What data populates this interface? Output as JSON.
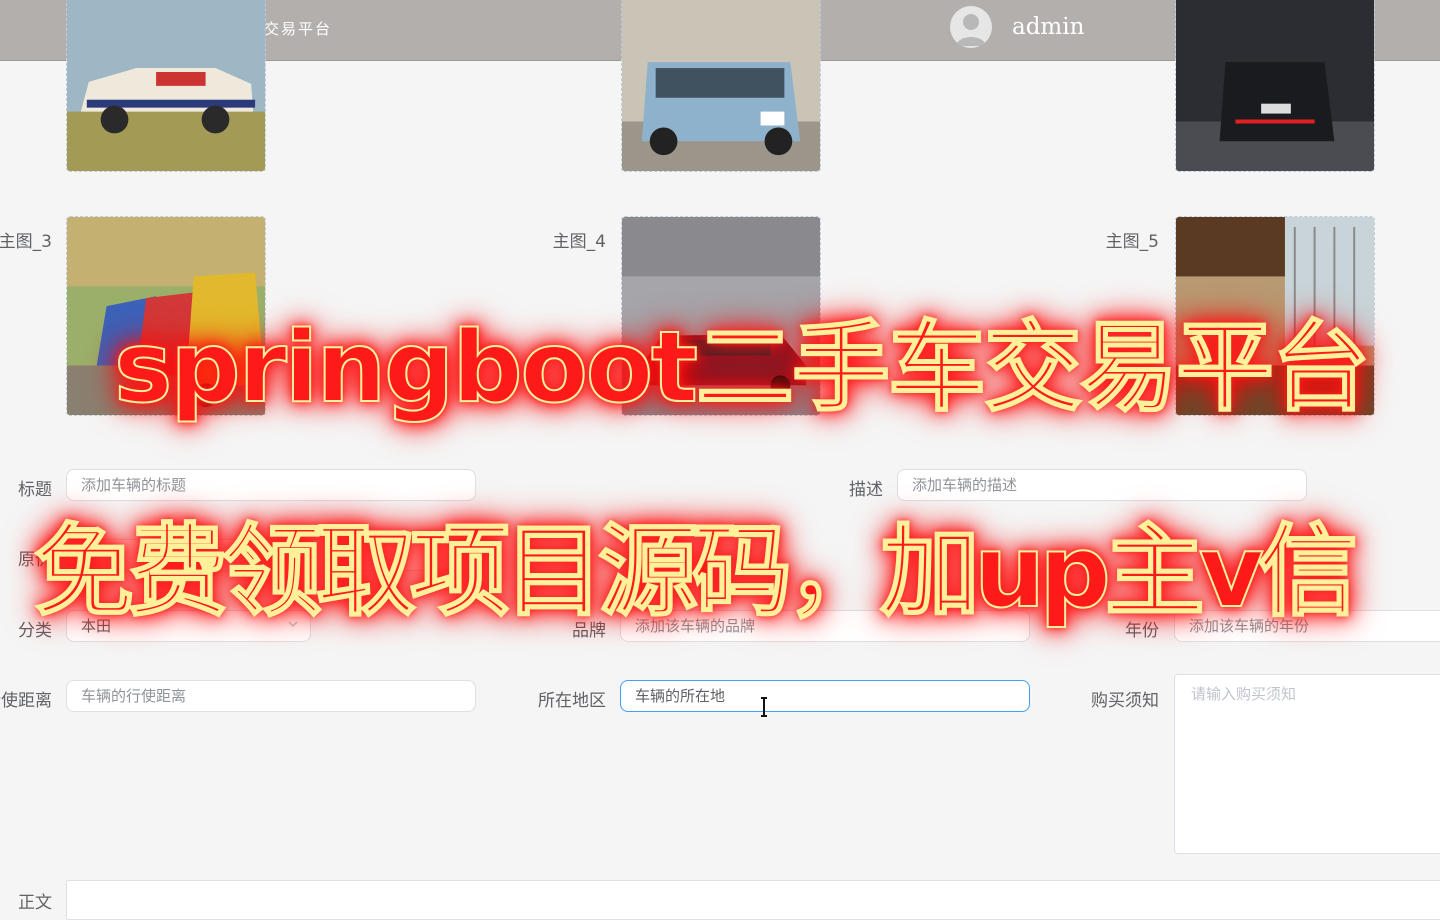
{
  "header": {
    "welcome": "欢迎使用二手车交易平台",
    "username": "admin"
  },
  "images": {
    "main3_label": "主图_3",
    "main4_label": "主图_4",
    "main5_label": "主图_5"
  },
  "form": {
    "title_label": "标题",
    "title_placeholder": "添加车辆的标题",
    "desc_label": "描述",
    "desc_placeholder": "添加车辆的描述",
    "price_label": "原价",
    "category_label": "分类",
    "category_value": "本田",
    "brand_label": "品牌",
    "brand_placeholder": "添加该车辆的品牌",
    "year_label": "年份",
    "year_placeholder": "添加该车辆的年份",
    "mileage_label": "行使距离",
    "mileage_placeholder": "车辆的行使距离",
    "region_label": "所在地区",
    "region_value": "车辆的所在地",
    "notice_label": "购买须知",
    "notice_placeholder": "请输入购买须知",
    "content_label": "正文"
  },
  "overlay": {
    "line1": "springboot二手车交易平台",
    "line2": "免费领取项目源码，加up主v信"
  },
  "colors": {
    "header_bg": "#b3afad",
    "overlay_text": "#ff1a1a",
    "focus_border": "#409eff"
  }
}
